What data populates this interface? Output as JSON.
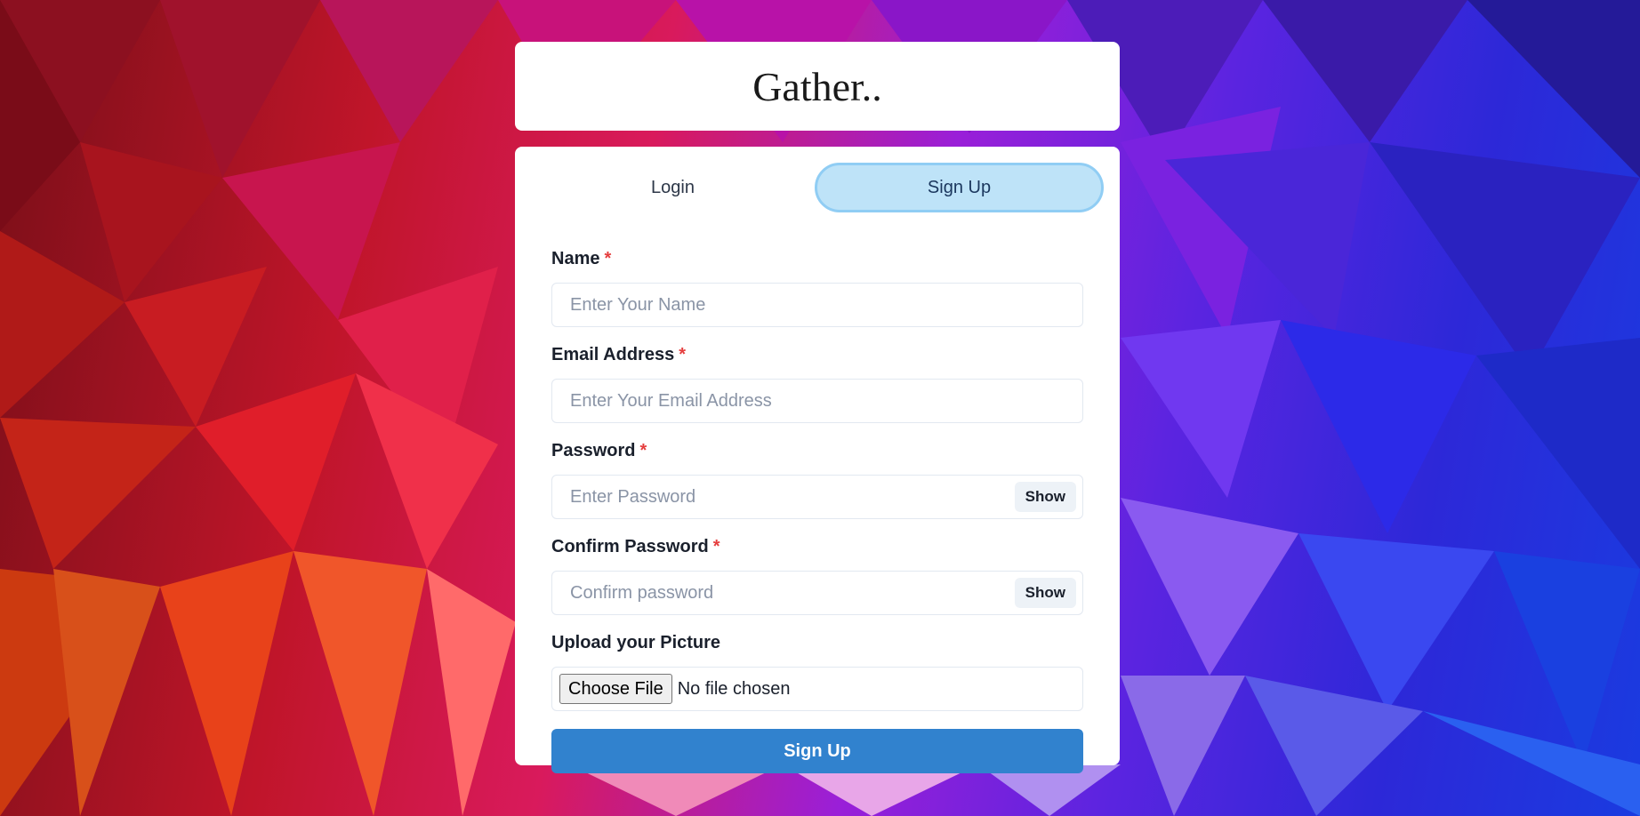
{
  "app": {
    "title": "Gather.."
  },
  "tabs": [
    {
      "label": "Login",
      "active": false
    },
    {
      "label": "Sign Up",
      "active": true
    }
  ],
  "form": {
    "name": {
      "label": "Name",
      "required_mark": "*",
      "placeholder": "Enter Your Name",
      "value": ""
    },
    "email": {
      "label": "Email Address",
      "required_mark": "*",
      "placeholder": "Enter Your Email Address",
      "value": ""
    },
    "password": {
      "label": "Password",
      "required_mark": "*",
      "placeholder": "Enter Password",
      "value": "",
      "toggle_label": "Show"
    },
    "confirm_password": {
      "label": "Confirm Password",
      "required_mark": "*",
      "placeholder": "Confirm password",
      "value": "",
      "toggle_label": "Show"
    },
    "picture": {
      "label": "Upload your Picture",
      "button_label": "Choose File",
      "status": "No file chosen"
    },
    "submit_label": "Sign Up"
  },
  "colors": {
    "primary_button": "#3182ce",
    "active_tab_bg": "#bee3f8",
    "active_tab_border": "#90cdf4",
    "required": "#e53e3e"
  }
}
